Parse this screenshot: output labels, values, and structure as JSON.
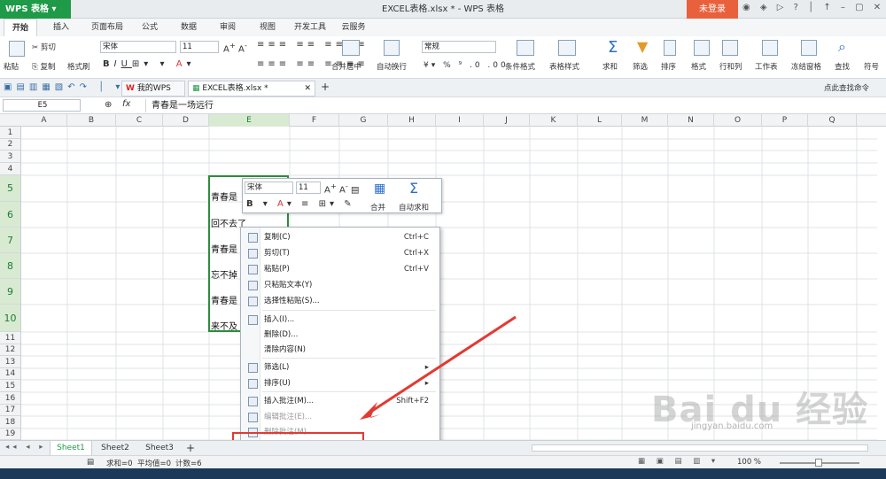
{
  "app": {
    "name": "WPS 表格",
    "doc_title": "EXCEL表格.xlsx * - WPS 表格",
    "login": "未登录"
  },
  "tabs": [
    "开始",
    "插入",
    "页面布局",
    "公式",
    "数据",
    "审阅",
    "视图",
    "开发工具",
    "云服务"
  ],
  "ribbon": {
    "paste": "粘贴",
    "cut": "剪切",
    "copy": "复制",
    "format_painter": "格式刷",
    "font": "宋体",
    "size": "11",
    "merge": "合并居中",
    "wrap": "自动换行",
    "numfmt": "常规",
    "cond_fmt": "条件格式",
    "table_style": "表格样式",
    "sum": "求和",
    "filter": "筛选",
    "sort": "排序",
    "format": "格式",
    "rowcol": "行和列",
    "sheet": "工作表",
    "freeze": "冻结窗格",
    "find": "查找",
    "sym": "符号"
  },
  "doc_tabs": [
    "我的WPS",
    "EXCEL表格.xlsx *"
  ],
  "search_cmd": "点此查找命令",
  "formula": {
    "cell_ref": "E5",
    "fx": "fx",
    "content": "青春是一场远行"
  },
  "columns": [
    "A",
    "B",
    "C",
    "D",
    "E",
    "F",
    "G",
    "H",
    "I",
    "J",
    "K",
    "L",
    "M",
    "N",
    "O",
    "P",
    "Q"
  ],
  "rows": [
    "1",
    "2",
    "3",
    "4",
    "5",
    "6",
    "7",
    "8",
    "9",
    "10",
    "11",
    "12",
    "13",
    "14",
    "15",
    "16",
    "17",
    "18",
    "19"
  ],
  "cells": [
    "青春是",
    "回不去了",
    "青春是",
    "忘不掉",
    "青春是",
    "来不及"
  ],
  "mini_toolbar": {
    "font": "宋体",
    "size": "11",
    "merge": "合并",
    "autosum": "自动求和"
  },
  "context_menu": [
    {
      "label": "复制(C)",
      "shortcut": "Ctrl+C",
      "icon": "copy-icon"
    },
    {
      "label": "剪切(T)",
      "shortcut": "Ctrl+X",
      "icon": "scissors-icon"
    },
    {
      "label": "粘贴(P)",
      "shortcut": "Ctrl+V",
      "icon": "paste-icon"
    },
    {
      "label": "只粘贴文本(Y)",
      "shortcut": "",
      "icon": "paste-text-icon"
    },
    {
      "label": "选择性粘贴(S)...",
      "shortcut": "",
      "icon": "paste-special-icon"
    },
    {
      "label": "插入(I)...",
      "shortcut": "",
      "icon": "insert-icon"
    },
    {
      "label": "删除(D)...",
      "shortcut": "",
      "icon": ""
    },
    {
      "label": "清除内容(N)",
      "shortcut": "",
      "icon": ""
    },
    {
      "label": "筛选(L)",
      "shortcut": "▸",
      "icon": "filter-icon"
    },
    {
      "label": "排序(U)",
      "shortcut": "▸",
      "icon": "sort-icon"
    },
    {
      "label": "插入批注(M)...",
      "shortcut": "Shift+F2",
      "icon": "comment-icon"
    },
    {
      "label": "编辑批注(E)...",
      "shortcut": "",
      "icon": "edit-comment-icon"
    },
    {
      "label": "删除批注(M)",
      "shortcut": "",
      "icon": "delete-comment-icon"
    },
    {
      "label": "设置单元格格式(F)...",
      "shortcut": "Ctrl+1",
      "icon": "format-cells-icon"
    }
  ],
  "sheets": [
    "Sheet1",
    "Sheet2",
    "Sheet3"
  ],
  "status": {
    "sum": "求和=0",
    "avg": "平均值=0",
    "count": "计数=6",
    "zoom": "100 %"
  },
  "watermark": {
    "brand": "Bai du 经验",
    "url": "jingyan.baidu.com"
  },
  "colors": {
    "wps_green": "#1e9a48",
    "login": "#e8613c",
    "highlight": "#e23a32",
    "select": "#2e8b3f"
  }
}
